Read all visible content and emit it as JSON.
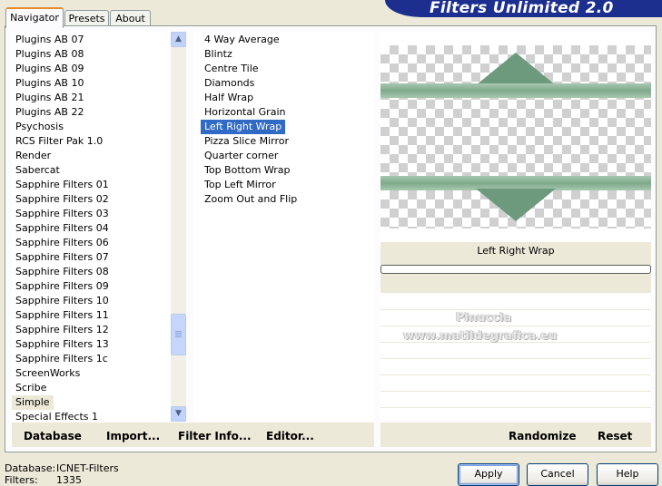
{
  "window": {
    "title": "Filters Unlimited 2.0"
  },
  "tabs": [
    {
      "label": "Navigator"
    },
    {
      "label": "Presets"
    },
    {
      "label": "About"
    }
  ],
  "categories": {
    "selected": "Simple",
    "items": [
      "Plugins AB 07",
      "Plugins AB 08",
      "Plugins AB 09",
      "Plugins AB 10",
      "Plugins AB 21",
      "Plugins AB 22",
      "Psychosis",
      "RCS Filter Pak 1.0",
      "Render",
      "Sabercat",
      "Sapphire Filters 01",
      "Sapphire Filters 02",
      "Sapphire Filters 03",
      "Sapphire Filters 04",
      "Sapphire Filters 06",
      "Sapphire Filters 07",
      "Sapphire Filters 08",
      "Sapphire Filters 09",
      "Sapphire Filters 10",
      "Sapphire Filters 11",
      "Sapphire Filters 12",
      "Sapphire Filters 13",
      "Sapphire Filters 1c",
      "ScreenWorks",
      "Scribe",
      "Simple",
      "Special Effects 1"
    ]
  },
  "filters": {
    "selected": "Left Right Wrap",
    "items": [
      "4 Way Average",
      "Blintz",
      "Centre Tile",
      "Diamonds",
      "Half Wrap",
      "Horizontal Grain",
      "Left Right Wrap",
      "Pizza Slice Mirror",
      "Quarter corner",
      "Top Bottom Wrap",
      "Top Left Mirror",
      "Zoom Out and Flip"
    ]
  },
  "scroll_icons": {
    "up": "arrow-up-icon",
    "down": "arrow-down-icon"
  },
  "toolbar": {
    "database_label": "Database",
    "import_label": "Import...",
    "filter_info_label": "Filter Info...",
    "editor_label": "Editor...",
    "randomize_label": "Randomize",
    "reset_label": "Reset"
  },
  "preview": {
    "filter_name": "Left Right Wrap",
    "watermark_line1": "Pinuccia",
    "watermark_line2": "www.matildegrafica.eu",
    "shape_color": "#6d9a7c"
  },
  "status": {
    "database_label": "Database:",
    "database_value": "ICNET-Filters",
    "filters_label": "Filters:",
    "filters_value": "1335"
  },
  "buttons": {
    "apply_label": "Apply",
    "cancel_label": "Cancel",
    "help_label": "Help"
  },
  "colors": {
    "banner": "#1c2f8f",
    "selection": "#316ac5",
    "dialog_bg": "#ece9d8",
    "tab_accent": "#e68b2c"
  }
}
